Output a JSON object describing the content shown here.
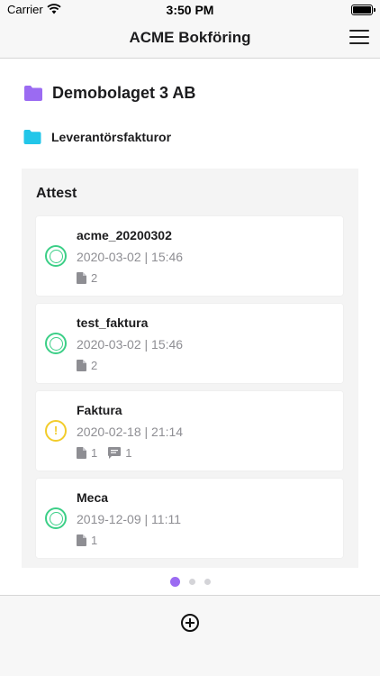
{
  "status_bar": {
    "carrier": "Carrier",
    "time": "3:50 PM"
  },
  "nav": {
    "title": "ACME Bokföring",
    "menu_icon": "hamburger-menu-icon"
  },
  "company": {
    "name": "Demobolaget 3 AB",
    "icon": "folder-icon",
    "icon_color": "#9b6bf2"
  },
  "folder": {
    "name": "Leverantörsfakturor",
    "icon": "folder-icon",
    "icon_color": "#22c6e9"
  },
  "attest": {
    "title": "Attest",
    "items": [
      {
        "name": "acme_20200302",
        "date": "2020-03-02 | 15:46",
        "status": "ok",
        "documents": "2",
        "comments": ""
      },
      {
        "name": "test_faktura",
        "date": "2020-03-02 | 15:46",
        "status": "ok",
        "documents": "2",
        "comments": ""
      },
      {
        "name": "Faktura",
        "date": "2020-02-18 | 21:14",
        "status": "warning",
        "status_symbol": "!",
        "documents": "1",
        "comments": "1"
      },
      {
        "name": "Meca",
        "date": "2019-12-09 | 11:11",
        "status": "ok",
        "documents": "1",
        "comments": ""
      }
    ]
  },
  "pager": {
    "pages": 3,
    "active": 0
  },
  "tab_bar": {
    "add_icon": "plus-circle-icon"
  },
  "colors": {
    "ok": "#3ccf87",
    "warning": "#f2cc2b",
    "accent": "#9b6bf2",
    "folder_cyan": "#22c6e9"
  }
}
